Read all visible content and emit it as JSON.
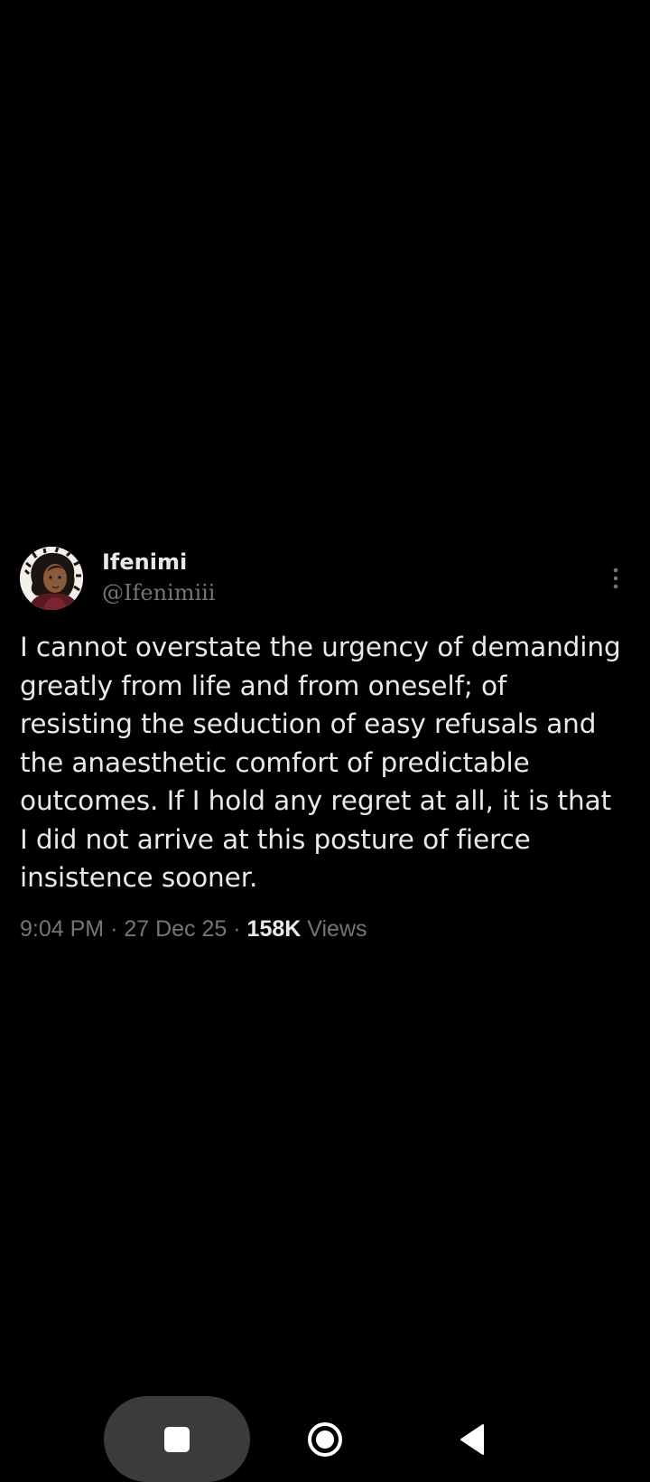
{
  "tweet": {
    "display_name": "Ifenimi",
    "handle": "@Ifenimiii",
    "text": "I cannot overstate the urgency of demanding greatly from life and from oneself; of resisting the seduction of easy refusals and the anaesthetic comfort of predictable outcomes. If I hold any regret at all, it is that I did not arrive at this posture of fierce insistence sooner.",
    "time": "9:04 PM",
    "separator": "·",
    "date": "27 Dec 25",
    "views_count": "158K",
    "views_label": "Views"
  },
  "icons": {
    "more": "more-vertical-icon",
    "recents": "square-icon",
    "home": "circle-icon",
    "back": "triangle-back-icon"
  },
  "colors": {
    "background": "#000000",
    "primary_text": "#e7e9ea",
    "secondary_text": "#71767b",
    "nav_pill": "#3b3b3b"
  }
}
